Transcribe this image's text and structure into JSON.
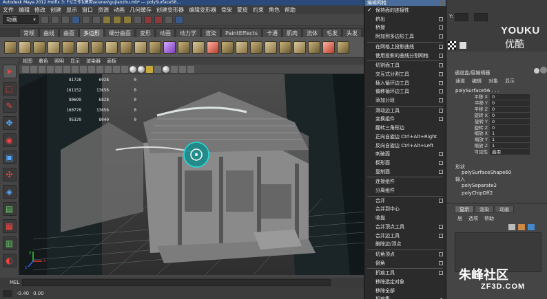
{
  "window": {
    "title": "Autodesk Maya 2012 Hotfix 3: F:\\[工作]\\建筑\\scenes\\gujianzhu.mb*   ---   polySurface56..."
  },
  "menubar": [
    "文件",
    "编辑",
    "修改",
    "创建",
    "显示",
    "窗口",
    "资源",
    "动画",
    "几何缓存",
    "创建变形器",
    "编辑变形器",
    "骨架",
    "蒙皮",
    "约束",
    "角色",
    "帮助"
  ],
  "status": {
    "mode": "动画"
  },
  "shelf": {
    "tabs": [
      "常规",
      "曲线",
      "曲面",
      "多边形",
      "细分曲面",
      "变形",
      "动画",
      "动力学",
      "渲染",
      "PaintEffects",
      "卡通",
      "肌肉",
      "流体",
      "毛发",
      "头发"
    ],
    "active_tab": "多边形"
  },
  "viewport": {
    "menu": [
      "视图",
      "着色",
      "照明",
      "显示",
      "渲染器",
      "面板"
    ],
    "hud": [
      [
        "",
        "81728",
        "6928",
        "0"
      ],
      [
        "",
        "161152",
        "13656",
        "0"
      ],
      [
        "",
        "80699",
        "6828",
        "0"
      ],
      [
        "",
        "160770",
        "13656",
        "0"
      ],
      [
        "",
        "95329",
        "8040",
        "0"
      ]
    ],
    "axis_labels": [
      "y",
      "x",
      "z"
    ]
  },
  "edit_mesh_menu": {
    "title": "编辑网格",
    "items": [
      {
        "label": "保持面的连接性",
        "check": true
      },
      {
        "label": "挤出",
        "opt": true
      },
      {
        "label": "桥接",
        "opt": true
      },
      {
        "label": "附加到多边形工具",
        "opt": true
      },
      {
        "sep": true
      },
      {
        "label": "在网格上投影曲线",
        "opt": true
      },
      {
        "label": "使用投影的曲线分割网格",
        "opt": true
      },
      {
        "sep": true
      },
      {
        "label": "切割面工具",
        "opt": true
      },
      {
        "label": "交互式分割工具",
        "opt": true
      },
      {
        "label": "插入循环边工具",
        "opt": true
      },
      {
        "label": "偏移循环边工具",
        "opt": true
      },
      {
        "label": "添加分段",
        "opt": true
      },
      {
        "sep": true
      },
      {
        "label": "滑动边工具",
        "opt": true
      },
      {
        "label": "变换组件",
        "opt": true
      },
      {
        "label": "翻转三角形边"
      },
      {
        "label": "正向自旋边  Ctrl+Alt+Right"
      },
      {
        "label": "反向自旋边  Ctrl+Alt+Left"
      },
      {
        "label": "刺破面",
        "opt": true
      },
      {
        "label": "楔形面",
        "opt": true
      },
      {
        "label": "复制面",
        "opt": true
      },
      {
        "sep": true
      },
      {
        "label": "连接组件"
      },
      {
        "label": "分离组件"
      },
      {
        "sep": true
      },
      {
        "label": "合并",
        "opt": true
      },
      {
        "label": "合并到中心"
      },
      {
        "label": "收拢"
      },
      {
        "label": "合并顶点工具",
        "opt": true
      },
      {
        "label": "合并边工具",
        "opt": true
      },
      {
        "label": "删除边/顶点"
      },
      {
        "sep": true
      },
      {
        "label": "切角顶点",
        "opt": true
      },
      {
        "label": "倒角",
        "opt": true
      },
      {
        "sep": true
      },
      {
        "label": "折痕工具",
        "opt": true
      },
      {
        "label": "移除选定对象"
      },
      {
        "label": "移除全部"
      },
      {
        "label": "折痕集",
        "arrow": true
      }
    ]
  },
  "right_panel": {
    "coord_label": "Y:",
    "brand": "YOUKU",
    "brand_cn": "优酷"
  },
  "channel_box": {
    "menu": [
      "通道",
      "编辑",
      "对象",
      "显示"
    ],
    "header_label": "通道盒/层编辑器",
    "node": "polySurface56 . . .",
    "attrs": [
      {
        "name": "平移 X",
        "value": "0"
      },
      {
        "name": "平移 Y",
        "value": "0"
      },
      {
        "name": "平移 Z",
        "value": "0"
      },
      {
        "name": "旋转 X",
        "value": "0"
      },
      {
        "name": "旋转 Y",
        "value": "0"
      },
      {
        "name": "旋转 Z",
        "value": "0"
      },
      {
        "name": "缩放 X",
        "value": "1"
      },
      {
        "name": "缩放 Y",
        "value": "1"
      },
      {
        "name": "缩放 Z",
        "value": "1"
      },
      {
        "name": "可见性",
        "value": "启用"
      }
    ],
    "shape_label": "形状",
    "shape": "polySurfaceShape60",
    "input_label": "输入",
    "inputs": [
      "polySeparate2",
      "polyChipOff2"
    ]
  },
  "layers": {
    "tabs": [
      "显示",
      "渲染",
      "动画"
    ],
    "active_tab": "显示",
    "menu": [
      "层",
      "选项",
      "帮助"
    ]
  },
  "watermark": {
    "text": "朱峰社区",
    "sub": "ZF3D.COM"
  },
  "command_line": {
    "label": "MEL"
  },
  "help_line": {
    "values": [
      "-0.40",
      "0.00"
    ]
  }
}
